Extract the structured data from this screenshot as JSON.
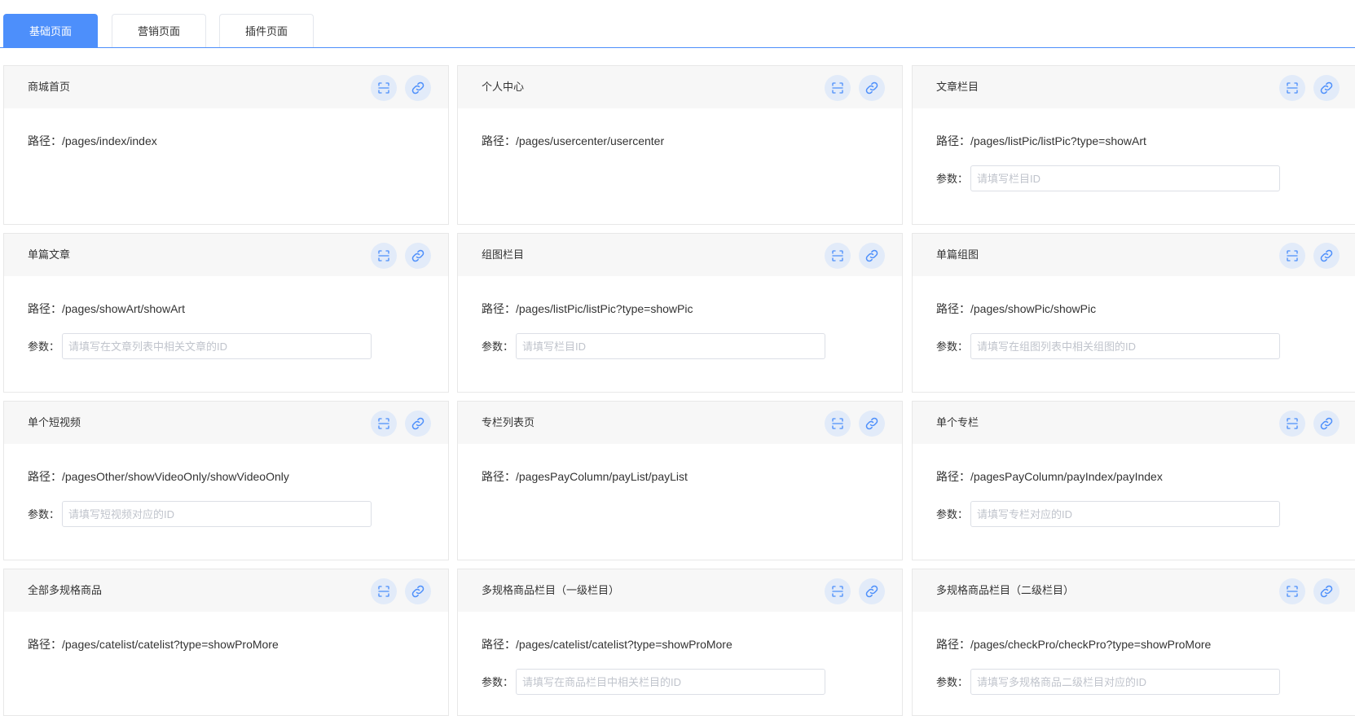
{
  "tabs": [
    {
      "label": "基础页面",
      "active": true
    },
    {
      "label": "营销页面",
      "active": false
    },
    {
      "label": "插件页面",
      "active": false
    }
  ],
  "path_prefix": "路径：",
  "param_label": "参数：",
  "colors": {
    "accent": "#4d8ffb",
    "icon_bg": "#e2ebf9",
    "header_bg": "#f7f7f7"
  },
  "icons": {
    "scan": "scan-icon",
    "link": "link-icon"
  },
  "cards": [
    {
      "title": "商城首页",
      "path": "/pages/index/index"
    },
    {
      "title": "个人中心",
      "path": "/pages/usercenter/usercenter"
    },
    {
      "title": "文章栏目",
      "path": "/pages/listPic/listPic?type=showArt",
      "param": {
        "value": "",
        "placeholder": "请填写栏目ID"
      }
    },
    {
      "title": "单篇文章",
      "path": "/pages/showArt/showArt",
      "param": {
        "value": "",
        "placeholder": "请填写在文章列表中相关文章的ID"
      }
    },
    {
      "title": "组图栏目",
      "path": "/pages/listPic/listPic?type=showPic",
      "param": {
        "value": "",
        "placeholder": "请填写栏目ID"
      }
    },
    {
      "title": "单篇组图",
      "path": "/pages/showPic/showPic",
      "param": {
        "value": "",
        "placeholder": "请填写在组图列表中相关组图的ID"
      }
    },
    {
      "title": "单个短视频",
      "path": "/pagesOther/showVideoOnly/showVideoOnly",
      "param": {
        "value": "",
        "placeholder": "请填写短视频对应的ID"
      }
    },
    {
      "title": "专栏列表页",
      "path": "/pagesPayColumn/payList/payList"
    },
    {
      "title": "单个专栏",
      "path": "/pagesPayColumn/payIndex/payIndex",
      "param": {
        "value": "",
        "placeholder": "请填写专栏对应的ID"
      }
    },
    {
      "title": "全部多规格商品",
      "path": "/pages/catelist/catelist?type=showProMore"
    },
    {
      "title": "多规格商品栏目（一级栏目）",
      "path": "/pages/catelist/catelist?type=showProMore",
      "param": {
        "value": "",
        "placeholder": "请填写在商品栏目中相关栏目的ID"
      }
    },
    {
      "title": "多规格商品栏目（二级栏目）",
      "path": "/pages/checkPro/checkPro?type=showProMore",
      "param": {
        "value": "",
        "placeholder": "请填写多规格商品二级栏目对应的ID"
      }
    }
  ]
}
